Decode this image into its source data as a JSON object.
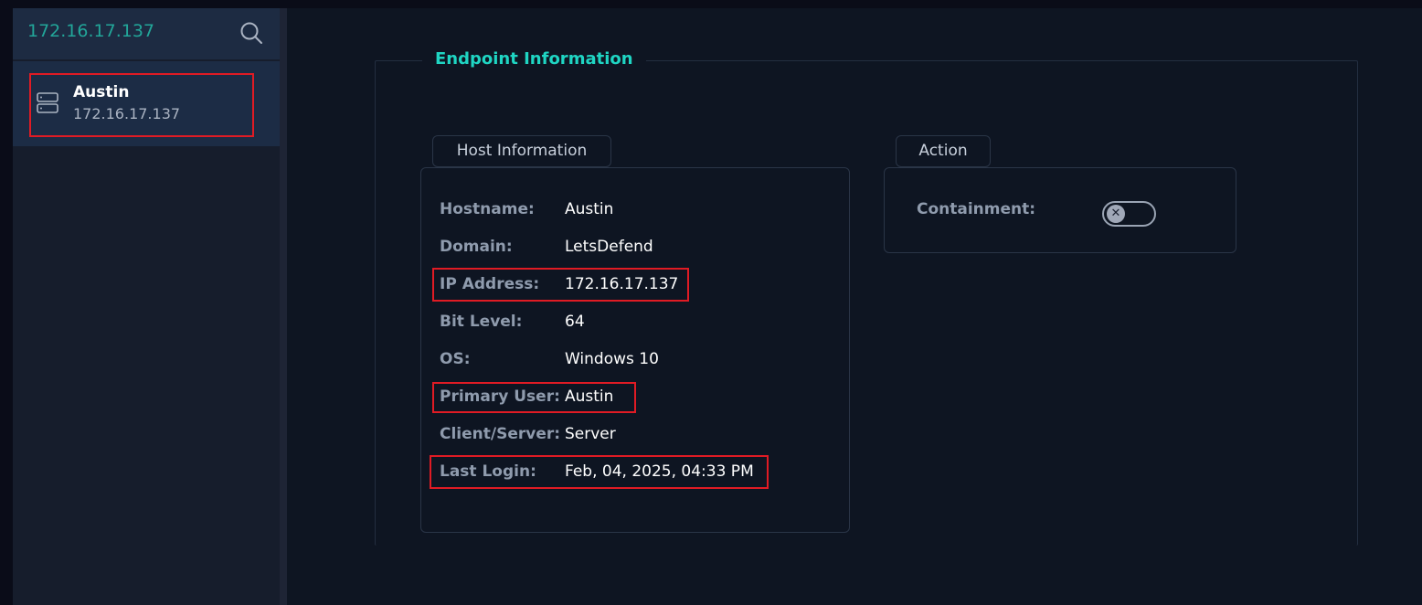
{
  "sidebar": {
    "search": {
      "value": "172.16.17.137"
    },
    "endpoints": [
      {
        "name": "Austin",
        "ip": "172.16.17.137",
        "icon": "server-icon"
      }
    ]
  },
  "main": {
    "section_title": "Endpoint Information",
    "host_information": {
      "label": "Host Information",
      "rows": [
        {
          "key": "Hostname:",
          "value": "Austin"
        },
        {
          "key": "Domain:",
          "value": "LetsDefend"
        },
        {
          "key": "IP Address:",
          "value": "172.16.17.137"
        },
        {
          "key": "Bit Level:",
          "value": "64"
        },
        {
          "key": "OS:",
          "value": "Windows 10"
        },
        {
          "key": "Primary User:",
          "value": "Austin"
        },
        {
          "key": "Client/Server:",
          "value": "Server"
        },
        {
          "key": "Last Login:",
          "value": "Feb, 04, 2025, 04:33 PM"
        }
      ]
    },
    "action": {
      "label": "Action",
      "containment_label": "Containment:",
      "containment_enabled": false
    }
  },
  "colors": {
    "accent": "#1fd5c3",
    "highlight": "#e01b24",
    "search_text": "#22a699"
  }
}
